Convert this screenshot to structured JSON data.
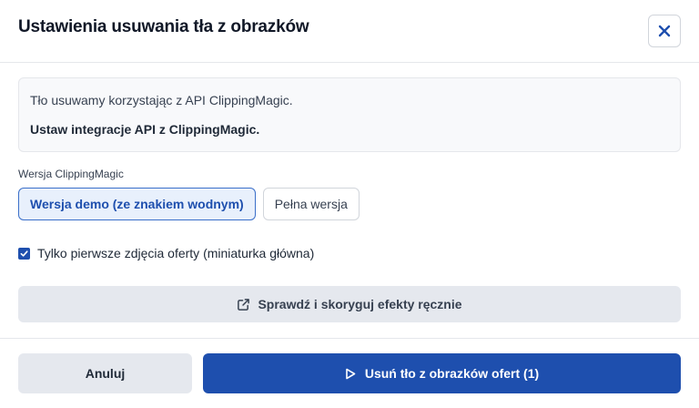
{
  "dialog": {
    "title": "Ustawienia usuwania tła z obrazków",
    "close_icon": "close-icon"
  },
  "info": {
    "line1": "Tło usuwamy korzystając z API ClippingMagic.",
    "line2": "Ustaw integracje API z ClippingMagic."
  },
  "version": {
    "label": "Wersja ClippingMagic",
    "options": [
      {
        "label": "Wersja demo (ze znakiem wodnym)",
        "selected": true
      },
      {
        "label": "Pełna wersja",
        "selected": false
      }
    ]
  },
  "checkbox": {
    "label": "Tylko pierwsze zdjęcia oferty (miniaturka główna)",
    "checked": true
  },
  "review_button": {
    "label": "Sprawdź i skoryguj efekty ręcznie",
    "icon": "external-link-icon"
  },
  "footer": {
    "cancel_label": "Anuluj",
    "submit_label": "Usuń tło z obrazków ofert (1)",
    "submit_icon": "play-icon"
  },
  "colors": {
    "primary": "#1e4fae",
    "selected_bg": "#e8f0fc",
    "secondary_bg": "#e5e8ee",
    "info_bg": "#f8f9fb"
  }
}
